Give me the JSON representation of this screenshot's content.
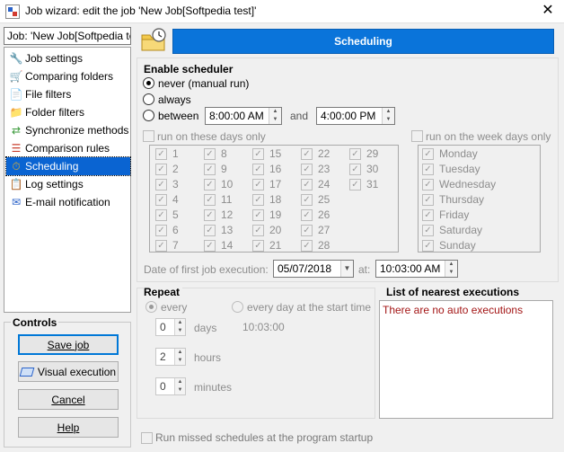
{
  "window": {
    "title": "Job wizard: edit the job 'New Job[Softpedia test]'",
    "close_glyph": "✕"
  },
  "job_field": "Job: 'New Job[Softpedia test]'",
  "nav": {
    "items": [
      {
        "label": "Job settings",
        "icon": "wrench-icon",
        "glyph": "🔧",
        "color": "#3c78c8"
      },
      {
        "label": "Comparing folders",
        "icon": "cart-icon",
        "glyph": "🛒",
        "color": "#2a62c9"
      },
      {
        "label": "File filters",
        "icon": "file-icon",
        "glyph": "📄",
        "color": "#444444"
      },
      {
        "label": "Folder filters",
        "icon": "folder-icon",
        "glyph": "📁",
        "color": "#e2b030"
      },
      {
        "label": "Synchronize methods",
        "icon": "sync-icon",
        "glyph": "⇄",
        "color": "#3a9a3a"
      },
      {
        "label": "Comparison rules",
        "icon": "rules-icon",
        "glyph": "☰",
        "color": "#c8402f"
      },
      {
        "label": "Scheduling",
        "icon": "scheduling-icon",
        "glyph": "⏱",
        "color": "#e2b030"
      },
      {
        "label": "Log settings",
        "icon": "log-icon",
        "glyph": "📋",
        "color": "#555555"
      },
      {
        "label": "E-mail notification",
        "icon": "email-icon",
        "glyph": "✉",
        "color": "#2a62c9"
      }
    ],
    "selected_index": 6
  },
  "controls": {
    "title": "Controls",
    "save_job": "Save job",
    "visual_execution": "Visual execution",
    "cancel": "Cancel",
    "help": "Help"
  },
  "header": {
    "title": "Scheduling"
  },
  "scheduler": {
    "section_title": "Enable scheduler",
    "never": "never (manual run)",
    "always": "always",
    "between": "between",
    "and": "and",
    "start_time": "8:00:00 AM",
    "end_time": "4:00:00 PM",
    "selected": "never"
  },
  "month_days": {
    "label": "run on these days only",
    "days": [
      "1",
      "2",
      "3",
      "4",
      "5",
      "6",
      "7",
      "8",
      "9",
      "10",
      "11",
      "12",
      "13",
      "14",
      "15",
      "16",
      "17",
      "18",
      "19",
      "20",
      "21",
      "22",
      "23",
      "24",
      "25",
      "26",
      "27",
      "28",
      "29",
      "30",
      "31"
    ]
  },
  "week_days": {
    "label": "run on the week days only",
    "days": [
      "Monday",
      "Tuesday",
      "Wednesday",
      "Thursday",
      "Friday",
      "Saturday",
      "Sunday"
    ]
  },
  "first_execution": {
    "label": "Date of first job execution:",
    "date": "05/07/2018",
    "at": "at:",
    "time": "10:03:00 AM"
  },
  "repeat": {
    "title": "Repeat",
    "every": "every",
    "every_day": "every day at the start time",
    "start_time_readout": "10:03:00",
    "days_value": "0",
    "days_label": "days",
    "hours_value": "2",
    "hours_label": "hours",
    "minutes_value": "0",
    "minutes_label": "minutes"
  },
  "nearest": {
    "title": "List of nearest executions",
    "message": "There are no auto executions"
  },
  "run_missed": "Run missed schedules at the program startup"
}
